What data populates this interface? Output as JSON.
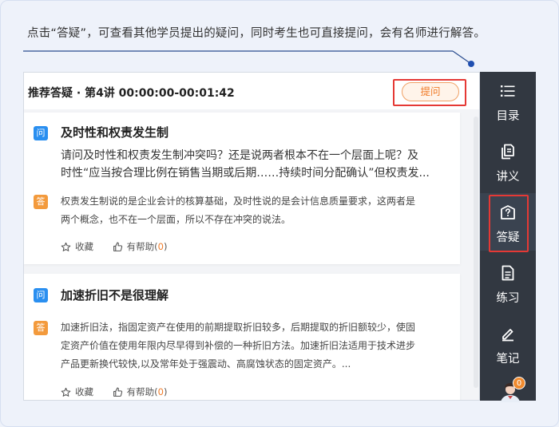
{
  "caption": "点击“答疑”，可查看其他学员提出的疑问，同时考生也可直接提问，会有名师进行解答。",
  "panel": {
    "title": "推荐答疑 · 第4讲 00:00:00-00:01:42",
    "ask_label": "提问"
  },
  "questions": [
    {
      "q_badge": "问",
      "title": "及时性和权责发生制",
      "body_lines": [
        "请问及时性和权责发生制冲突吗？还是说两者根本不在一个层面上呢？及",
        "时性“应当按合理比例在销售当期或后期……持续时间分配确认”但权责发..."
      ],
      "a_badge": "答",
      "answer_lines": [
        "权责发生制说的是企业会计的核算基础，及时性说的是会计信息质量要求，这两者是",
        "两个概念，也不在一个层面，所以不存在冲突的说法。"
      ],
      "favorite_label": "收藏",
      "helpful_label": "有帮助",
      "helpful_count": "0"
    },
    {
      "q_badge": "问",
      "title": "加速折旧不是很理解",
      "body_lines": [],
      "a_badge": "答",
      "answer_lines": [
        "加速折旧法，指固定资产在使用的前期提取折旧较多，后期提取的折旧额较少，使固",
        "定资产价值在使用年限内尽早得到补偿的一种折旧方法。加速折旧法适用于技术进步",
        "产品更新换代较快,以及常年处于强震动、高腐蚀状态的固定资产。..."
      ],
      "favorite_label": "收藏",
      "helpful_label": "有帮助",
      "helpful_count": "0"
    }
  ],
  "sidebar": {
    "items": [
      {
        "label": "目录",
        "icon": "list-icon"
      },
      {
        "label": "讲义",
        "icon": "handout-icon"
      },
      {
        "label": "答疑",
        "icon": "qa-icon"
      },
      {
        "label": "练习",
        "icon": "exercise-icon"
      },
      {
        "label": "笔记",
        "icon": "note-icon"
      }
    ],
    "active": "答疑",
    "avatar_badge": "0"
  },
  "colors": {
    "accent_orange": "#f07d2b",
    "question_blue": "#2a8ff0",
    "answer_orange": "#f39a3c",
    "sidebar_bg": "#323841",
    "highlight_red": "#e53935"
  }
}
